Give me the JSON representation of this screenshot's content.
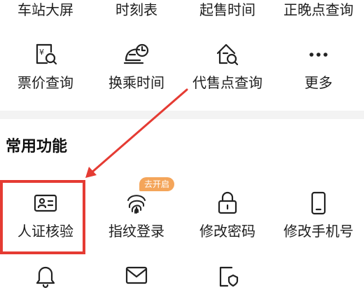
{
  "top_row": [
    {
      "label": "车站大屏"
    },
    {
      "label": "时刻表"
    },
    {
      "label": "起售时间"
    },
    {
      "label": "正晚点查询"
    }
  ],
  "services_row": [
    {
      "label": "票价查询",
      "icon": "ticket-price-search-icon"
    },
    {
      "label": "换乘时间",
      "icon": "transfer-time-icon"
    },
    {
      "label": "代售点查询",
      "icon": "agent-outlet-search-icon"
    },
    {
      "label": "更多",
      "icon": "more-dots-icon"
    }
  ],
  "common": {
    "title": "常用功能",
    "items": [
      {
        "label": "人证核验",
        "icon": "id-card-icon"
      },
      {
        "label": "指纹登录",
        "icon": "fingerprint-icon",
        "badge": "去开启"
      },
      {
        "label": "修改密码",
        "icon": "lock-icon"
      },
      {
        "label": "修改手机号",
        "icon": "phone-icon"
      }
    ],
    "partial_row_icons": [
      "bell-icon",
      "mail-icon",
      "shield-document-icon"
    ]
  },
  "colors": {
    "icon_stroke": "#222222",
    "badge_bg": "#f4a55a",
    "annotation_red": "#e53b33",
    "section_gap": "#f3f3f3"
  }
}
